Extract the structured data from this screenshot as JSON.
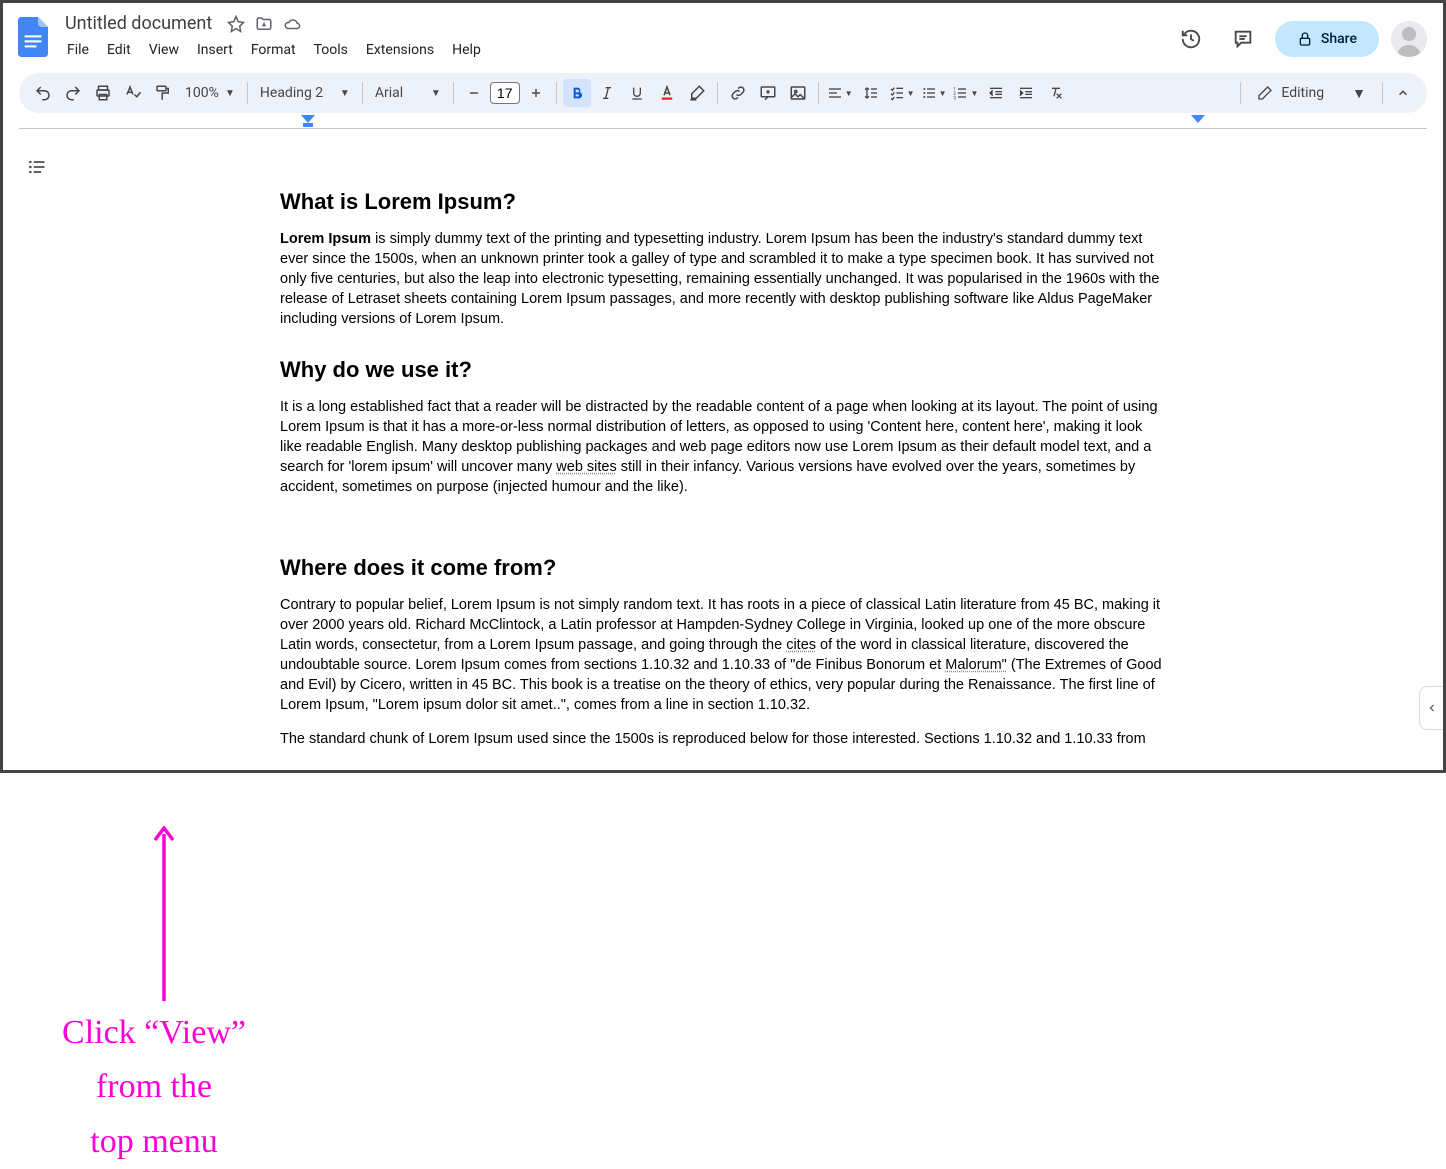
{
  "header": {
    "doc_title": "Untitled document",
    "menus": [
      "File",
      "Edit",
      "View",
      "Insert",
      "Format",
      "Tools",
      "Extensions",
      "Help"
    ],
    "share_label": "Share"
  },
  "toolbar": {
    "zoom": "100%",
    "paragraph_style": "Heading 2",
    "font": "Arial",
    "font_size": "17",
    "editing_mode": "Editing"
  },
  "document": {
    "h1": "What is Lorem Ipsum?",
    "p1_bold": "Lorem Ipsum",
    "p1_rest": " is simply dummy text of the printing and typesetting industry. Lorem Ipsum has been the industry's standard dummy text ever since the 1500s, when an unknown printer took a galley of type and scrambled it to make a type specimen book. It has survived not only five centuries, but also the leap into electronic typesetting, remaining essentially unchanged. It was popularised in the 1960s with the release of Letraset sheets containing Lorem Ipsum passages, and more recently with desktop publishing software like Aldus PageMaker including versions of Lorem Ipsum.",
    "h2": "Why do we use it?",
    "p2a": "It is a long established fact that a reader will be distracted by the readable content of a page when looking at its layout. The point of using Lorem Ipsum is that it has a more-or-less normal distribution of letters, as opposed to using 'Content here, content here', making it look like readable English. Many desktop publishing packages and web page editors now use Lorem Ipsum as their default model text, and a search for 'lorem ipsum' will uncover many ",
    "p2_dotted": "web sites",
    "p2b": " still in their infancy. Various versions have evolved over the years, sometimes by accident, sometimes on purpose (injected humour and the like).",
    "h3": "Where does it come from?",
    "p3a": "Contrary to popular belief, Lorem Ipsum is not simply random text. It has roots in a piece of classical Latin literature from 45 BC, making it over 2000 years old. Richard McClintock, a Latin professor at Hampden-Sydney College in Virginia, looked up one of the more obscure Latin words, consectetur, from a Lorem Ipsum passage, and going through the ",
    "p3_dotted1": "cites",
    "p3b": " of the word in classical literature, discovered the undoubtable source. Lorem Ipsum comes from sections 1.10.32 and 1.10.33 of \"de Finibus Bonorum et ",
    "p3_dotted2": "Malorum\"",
    "p3c": " (The Extremes of Good and Evil) by Cicero, written in 45 BC. This book is a treatise on the theory of ethics, very popular during the Renaissance. The first line of Lorem Ipsum, \"Lorem ipsum dolor sit amet..\", comes from a line in section 1.10.32.",
    "p4": "The standard chunk of Lorem Ipsum used since the 1500s is reproduced below for those interested. Sections 1.10.32 and 1.10.33 from"
  },
  "annotation": {
    "line1": "Click “View”",
    "line2": "from the",
    "line3": "top menu"
  }
}
